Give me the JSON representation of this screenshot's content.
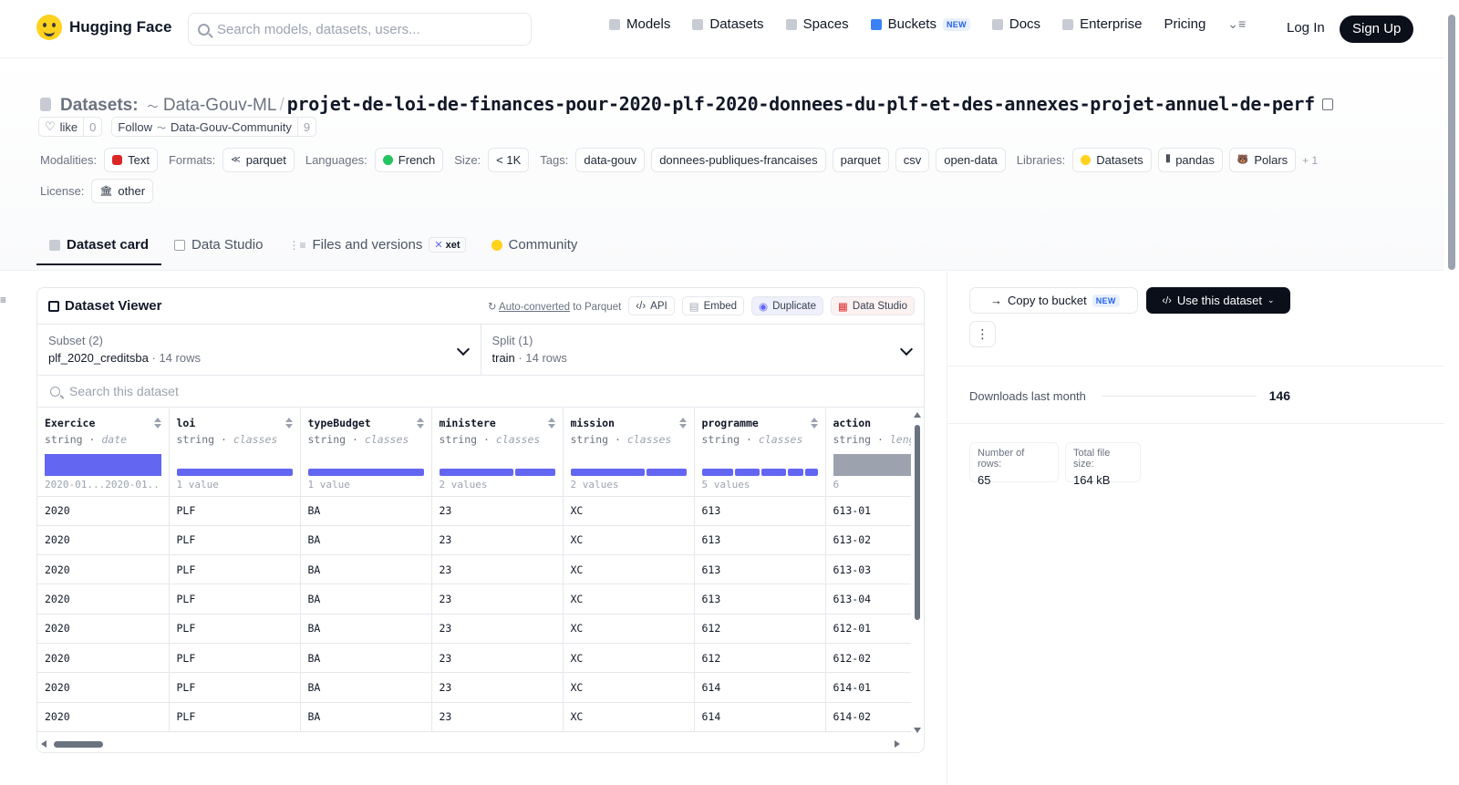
{
  "nav": {
    "brand": "Hugging Face",
    "search_placeholder": "Search models, datasets, users...",
    "items": [
      "Models",
      "Datasets",
      "Spaces",
      "Buckets",
      "Docs",
      "Enterprise",
      "Pricing"
    ],
    "buckets_badge": "NEW",
    "login": "Log In",
    "signup": "Sign Up"
  },
  "header": {
    "label": "Datasets:",
    "org": "Data-Gouv-ML",
    "separator": "/",
    "repo": "projet-de-loi-de-finances-pour-2020-plf-2020-donnees-du-plf-et-des-annexes-projet-annuel-de-perf",
    "like_label": "like",
    "like_count": "0",
    "follow_label": "Follow",
    "follow_org": "Data-Gouv-Community",
    "follow_count": "9"
  },
  "meta": {
    "modalities_label": "Modalities:",
    "modalities": [
      "Text"
    ],
    "formats_label": "Formats:",
    "formats": [
      "parquet"
    ],
    "languages_label": "Languages:",
    "languages": [
      "French"
    ],
    "size_label": "Size:",
    "size": "< 1K",
    "tags_label": "Tags:",
    "tags": [
      "data-gouv",
      "donnees-publiques-francaises",
      "parquet",
      "csv",
      "open-data"
    ],
    "libraries_label": "Libraries:",
    "libraries": [
      "Datasets",
      "pandas",
      "Polars"
    ],
    "libraries_more": "+ 1",
    "license_label": "License:",
    "license": "other"
  },
  "tabs": {
    "items": [
      "Dataset card",
      "Data Studio",
      "Files and versions",
      "Community"
    ],
    "xet_badge": "xet"
  },
  "viewer": {
    "title": "Dataset Viewer",
    "auto_converted_link": "Auto-converted",
    "auto_converted_rest": " to Parquet",
    "api": "API",
    "embed": "Embed",
    "duplicate": "Duplicate",
    "data_studio": "Data Studio",
    "subset_label": "Subset (2)",
    "subset_value": "plf_2020_creditsba",
    "subset_rows": "14 rows",
    "split_label": "Split (1)",
    "split_value": "train",
    "split_rows": "14 rows",
    "search_placeholder": "Search this dataset",
    "dot": "·",
    "columns": [
      {
        "name": "Exercice",
        "type": "string",
        "kind": "date",
        "hist_left": "2020-01...",
        "hist_right": "2020-01..."
      },
      {
        "name": "loi",
        "type": "string",
        "kind": "classes",
        "hist_left": "1 value",
        "hist_right": ""
      },
      {
        "name": "typeBudget",
        "type": "string",
        "kind": "classes",
        "hist_left": "1 value",
        "hist_right": ""
      },
      {
        "name": "ministere",
        "type": "string",
        "kind": "classes",
        "hist_left": "2 values",
        "hist_right": ""
      },
      {
        "name": "mission",
        "type": "string",
        "kind": "classes",
        "hist_left": "2 values",
        "hist_right": ""
      },
      {
        "name": "programme",
        "type": "string",
        "kind": "classes",
        "hist_left": "5 values",
        "hist_right": ""
      },
      {
        "name": "action",
        "type": "string",
        "kind": "leng",
        "hist_left": "6",
        "hist_right": ""
      }
    ],
    "rows": [
      [
        "2020",
        "PLF",
        "BA",
        "23",
        "XC",
        "613",
        "613-01"
      ],
      [
        "2020",
        "PLF",
        "BA",
        "23",
        "XC",
        "613",
        "613-02"
      ],
      [
        "2020",
        "PLF",
        "BA",
        "23",
        "XC",
        "613",
        "613-03"
      ],
      [
        "2020",
        "PLF",
        "BA",
        "23",
        "XC",
        "613",
        "613-04"
      ],
      [
        "2020",
        "PLF",
        "BA",
        "23",
        "XC",
        "612",
        "612-01"
      ],
      [
        "2020",
        "PLF",
        "BA",
        "23",
        "XC",
        "612",
        "612-02"
      ],
      [
        "2020",
        "PLF",
        "BA",
        "23",
        "XC",
        "614",
        "614-01"
      ],
      [
        "2020",
        "PLF",
        "BA",
        "23",
        "XC",
        "614",
        "614-02"
      ]
    ]
  },
  "sidebar": {
    "copy_to_bucket": "Copy to bucket",
    "copy_badge": "NEW",
    "use_dataset": "Use this dataset",
    "more": "⋮",
    "downloads_label": "Downloads last month",
    "downloads": "146",
    "rows_label": "Number of rows:",
    "rows_value": "65",
    "size_label": "Total file size:",
    "size_value": "164 kB"
  },
  "colors": {
    "accent": "#6366f1",
    "primary_button": "#0b0f19",
    "badge_blue": "#2563eb"
  }
}
